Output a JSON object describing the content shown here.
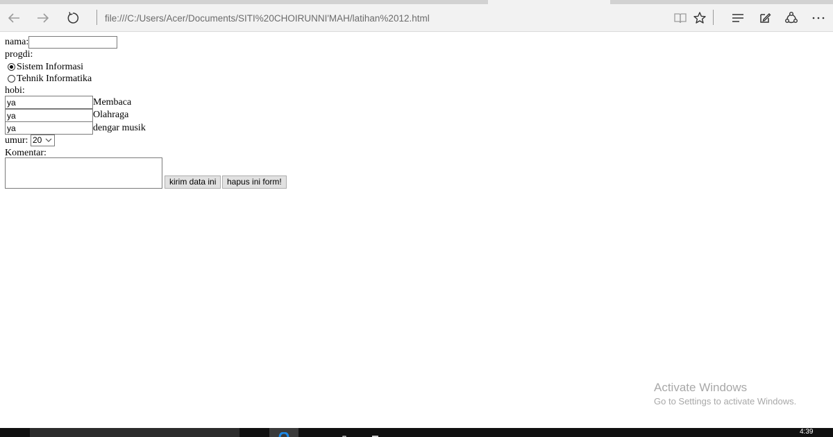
{
  "browser": {
    "address": "file:///C:/Users/Acer/Documents/SITI%20CHOIRUNNI'MAH/latihan%2012.html",
    "icons": [
      "back-icon",
      "forward-icon",
      "refresh-icon",
      "reading-view-icon",
      "favorite-star-icon",
      "hub-icon",
      "web-note-icon",
      "share-icon",
      "more-icon"
    ]
  },
  "form": {
    "nama_label": "nama:",
    "nama_value": "",
    "progdi_label": "progdi:",
    "progdi_options": [
      {
        "label": "Sistem Informasi",
        "checked": true
      },
      {
        "label": "Tehnik Informatika",
        "checked": false
      }
    ],
    "hobi_label": "hobi:",
    "hobi_rows": [
      {
        "value": "ya",
        "label": "Membaca"
      },
      {
        "value": "ya",
        "label": "Olahraga"
      },
      {
        "value": "ya",
        "label": "dengar musik"
      }
    ],
    "umur_label": "umur:",
    "umur_value": "20",
    "komentar_label": "Komentar:",
    "komentar_value": "",
    "submit_label": "kirim data ini",
    "reset_label": "hapus ini form!"
  },
  "watermark": {
    "title": "Activate Windows",
    "subtitle": "Go to Settings to activate Windows."
  },
  "taskbar": {
    "clock": "4:39"
  }
}
